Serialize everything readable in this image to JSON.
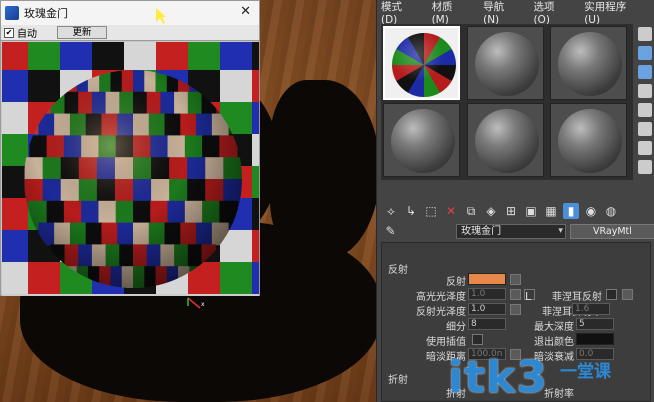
{
  "preview": {
    "title": "玫瑰金门",
    "auto_label": "自动",
    "update_button": "更新"
  },
  "editor": {
    "menu": [
      "模式(D)",
      "材质(M)",
      "导航(N)",
      "选项(O)",
      "实用程序(U)"
    ],
    "material_name": "玫瑰金门",
    "material_type": "VRayMtl",
    "reflection_section": "反射",
    "refraction_section": "折射",
    "labels": {
      "reflect": "反射",
      "hilight_gloss": "高光光泽度",
      "refl_gloss": "反射光泽度",
      "subdivs": "细分",
      "use_interp": "使用插值",
      "dim_dist": "暗淡距离",
      "fresnel": "菲涅耳反射",
      "fresnel_ior": "菲涅耳折射率",
      "max_depth": "最大深度",
      "exit_color": "退出颜色",
      "dim_falloff": "暗淡衰减",
      "refract_label": "折射",
      "refract_ior": "折射率",
      "l_button": "L"
    },
    "values": {
      "hilight_gloss": "1.0",
      "refl_gloss": "1.0",
      "subdivs": "8",
      "dim_dist": "100.0n",
      "fresnel_ior": "1.6",
      "max_depth": "5",
      "dim_falloff": "0.0"
    },
    "colors": {
      "reflect_swatch": "#e8874a",
      "active_tool": "#4a90d9"
    }
  },
  "watermark": {
    "text": "itk3",
    "cn": "一堂课"
  }
}
